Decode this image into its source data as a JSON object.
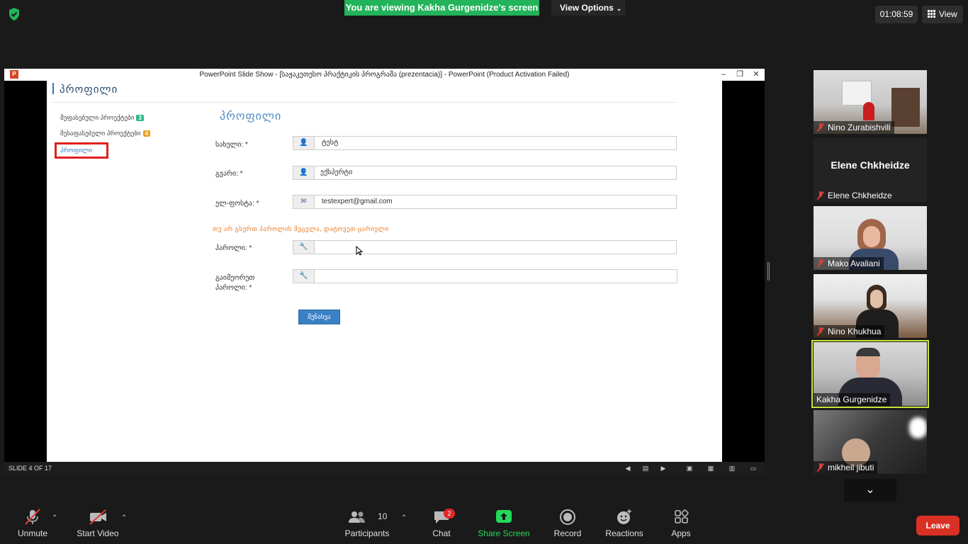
{
  "meeting": {
    "viewing_banner": "You are viewing Kakha Gurgenidze's screen",
    "view_options_label": "View Options",
    "timer": "01:08:59",
    "view_label": "View"
  },
  "ppt": {
    "window_title": "PowerPoint Slide Show - [საჟაკეთესო პრაქტიკის პროგრამა (prezentacia)] - PowerPoint (Product Activation Failed)",
    "app_icon_label": "P",
    "slide_counter": "SLIDE 4 OF 17"
  },
  "slide": {
    "header": "პროფილი",
    "sidebar": {
      "item1": "მეფასებული პროექტები",
      "item1_badge": "3",
      "item2": "შესაფასებელი პროექტები",
      "item2_badge": "4",
      "item3": "პროფილი"
    },
    "form_title": "პროფილი",
    "fields": {
      "first_name_label": "სახელი: *",
      "first_name_value": "ტესტ",
      "last_name_label": "გვარი: *",
      "last_name_value": "ექსპერტი",
      "email_label": "ელ-ფოსტა: *",
      "email_value": "testexpert@gmail.com",
      "password_hint": "თუ არ გსურთ პაროლის შეცვლა, დატოვეთ ცარიელი",
      "password_label": "პაროლი: *",
      "repeat_password_label_1": "გაიმეორეთ",
      "repeat_password_label_2": "პაროლი: *"
    },
    "save_button": "შენახვა"
  },
  "participants_panel": [
    {
      "name": "Nino Zurabishvili",
      "muted": true
    },
    {
      "name": "Elene Chkheidze",
      "muted": true,
      "video_off": true
    },
    {
      "name": "Mako Avaliani",
      "muted": true
    },
    {
      "name": "Nino Khukhua",
      "muted": true
    },
    {
      "name": "Kakha Gurgenidze",
      "muted": false,
      "active_speaker": true
    },
    {
      "name": "mikheil jibuti",
      "muted": true
    }
  ],
  "toolbar": {
    "unmute": "Unmute",
    "start_video": "Start Video",
    "participants": "Participants",
    "participants_count": "10",
    "chat": "Chat",
    "chat_badge": "2",
    "share_screen": "Share Screen",
    "record": "Record",
    "reactions": "Reactions",
    "apps": "Apps",
    "leave": "Leave"
  },
  "colors": {
    "banner_green": "#23b35a",
    "share_green": "#23d959",
    "leave_red": "#d93025",
    "active_speaker_border": "#c8e63c",
    "slide_accent": "#4f8bc6"
  }
}
